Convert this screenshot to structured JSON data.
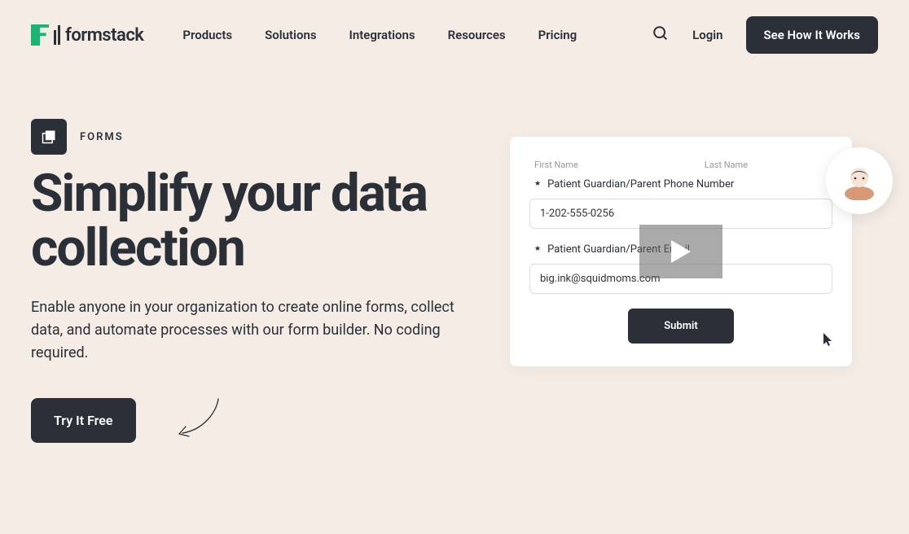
{
  "logo": {
    "text": "formstack"
  },
  "nav": {
    "items": [
      "Products",
      "Solutions",
      "Integrations",
      "Resources",
      "Pricing"
    ]
  },
  "header": {
    "login": "Login",
    "cta": "See How It Works"
  },
  "hero": {
    "eyebrow": "FORMS",
    "title": "Simplify your data collection",
    "subtitle": "Enable anyone in your organization to create online forms, collect data, and automate processes with our form builder. No coding required.",
    "cta": "Try It Free"
  },
  "video_preview": {
    "first_name_label": "First Name",
    "last_name_label": "Last Name",
    "phone_label": "Patient Guardian/Parent Phone Number",
    "phone_value": "1-202-555-0256",
    "email_label": "Patient Guardian/Parent Email",
    "email_value": "big.ink@squidmoms.com",
    "submit_label": "Submit"
  }
}
